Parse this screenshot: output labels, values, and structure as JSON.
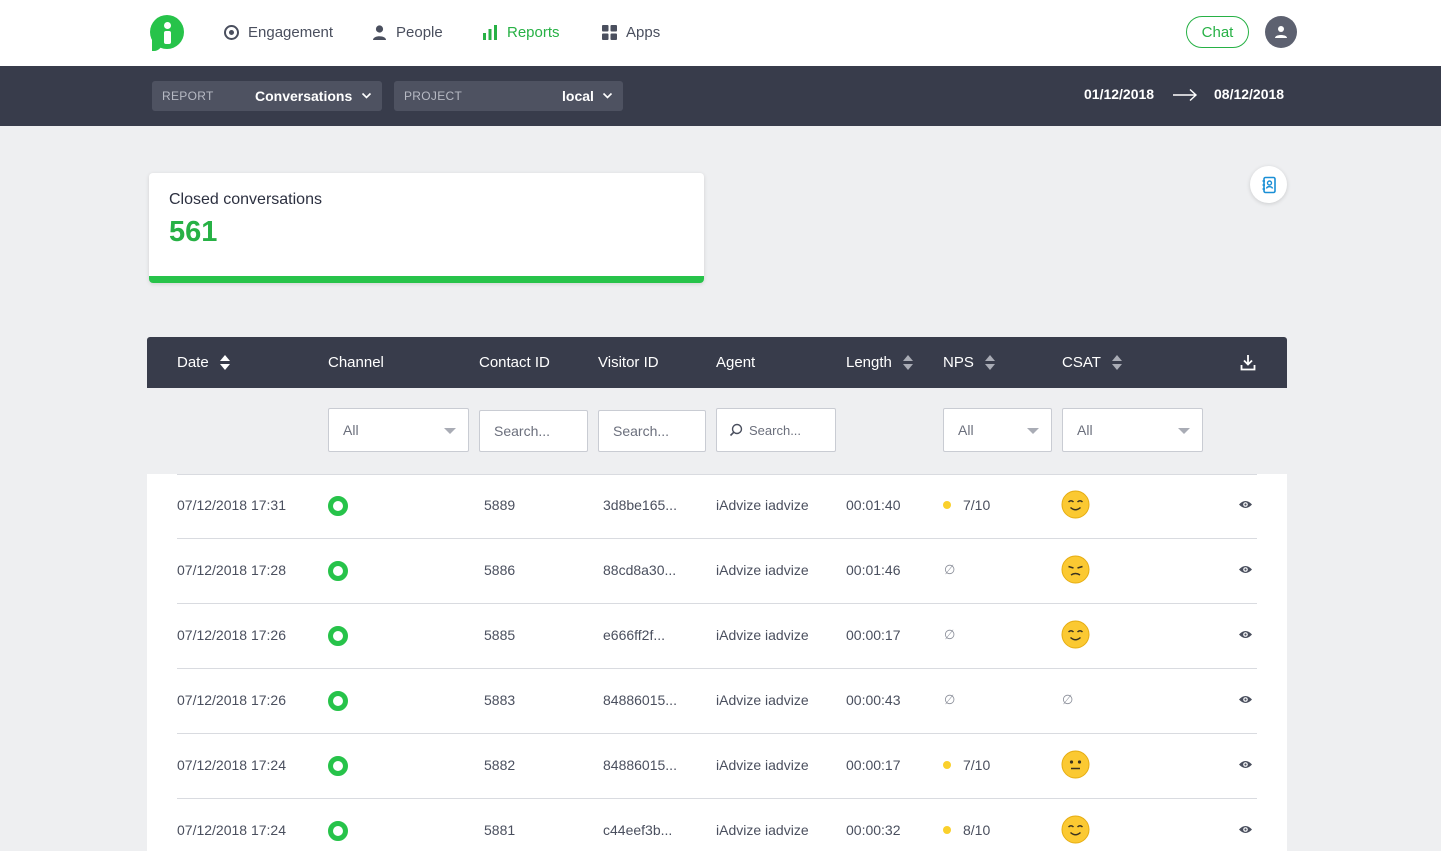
{
  "nav": {
    "items": [
      {
        "label": "Engagement",
        "icon": "target-icon",
        "active": false
      },
      {
        "label": "People",
        "icon": "person-icon",
        "active": false
      },
      {
        "label": "Reports",
        "icon": "bar-chart-icon",
        "active": true
      },
      {
        "label": "Apps",
        "icon": "grid-icon",
        "active": false
      }
    ],
    "chat_label": "Chat"
  },
  "report_bar": {
    "report_label": "REPORT",
    "report_value": "Conversations",
    "project_label": "PROJECT",
    "project_value": "local",
    "date_from": "01/12/2018",
    "date_to": "08/12/2018"
  },
  "kpi": {
    "title": "Closed conversations",
    "value": "561",
    "accent_color": "#27c34a"
  },
  "table": {
    "columns": [
      "Date",
      "Channel",
      "Contact ID",
      "Visitor ID",
      "Agent",
      "Length",
      "NPS",
      "CSAT"
    ],
    "filters": {
      "channel": "All",
      "contact_placeholder": "Search...",
      "visitor_placeholder": "Search...",
      "agent_placeholder": "Search...",
      "nps": "All",
      "csat": "All"
    },
    "rows": [
      {
        "date": "07/12/2018 17:31",
        "contact": "5889",
        "visitor": "3d8be165...",
        "agent": "iAdvize iadvize",
        "length": "00:01:40",
        "nps": "7/10",
        "csat": "happy"
      },
      {
        "date": "07/12/2018 17:28",
        "contact": "5886",
        "visitor": "88cd8a30...",
        "agent": "iAdvize iadvize",
        "length": "00:01:46",
        "nps": "∅",
        "csat": "sad"
      },
      {
        "date": "07/12/2018 17:26",
        "contact": "5885",
        "visitor": "e666ff2f...",
        "agent": "iAdvize iadvize",
        "length": "00:00:17",
        "nps": "∅",
        "csat": "happy"
      },
      {
        "date": "07/12/2018 17:26",
        "contact": "5883",
        "visitor": "84886015...",
        "agent": "iAdvize iadvize",
        "length": "00:00:43",
        "nps": "∅",
        "csat": "∅"
      },
      {
        "date": "07/12/2018 17:24",
        "contact": "5882",
        "visitor": "84886015...",
        "agent": "iAdvize iadvize",
        "length": "00:00:17",
        "nps": "7/10",
        "csat": "neutral"
      },
      {
        "date": "07/12/2018 17:24",
        "contact": "5881",
        "visitor": "c44eef3b...",
        "agent": "iAdvize iadvize",
        "length": "00:00:32",
        "nps": "8/10",
        "csat": "happy"
      }
    ]
  },
  "colors": {
    "brand": "#27c34a",
    "header": "#383c4b",
    "nps_dot": "#fad02c"
  }
}
